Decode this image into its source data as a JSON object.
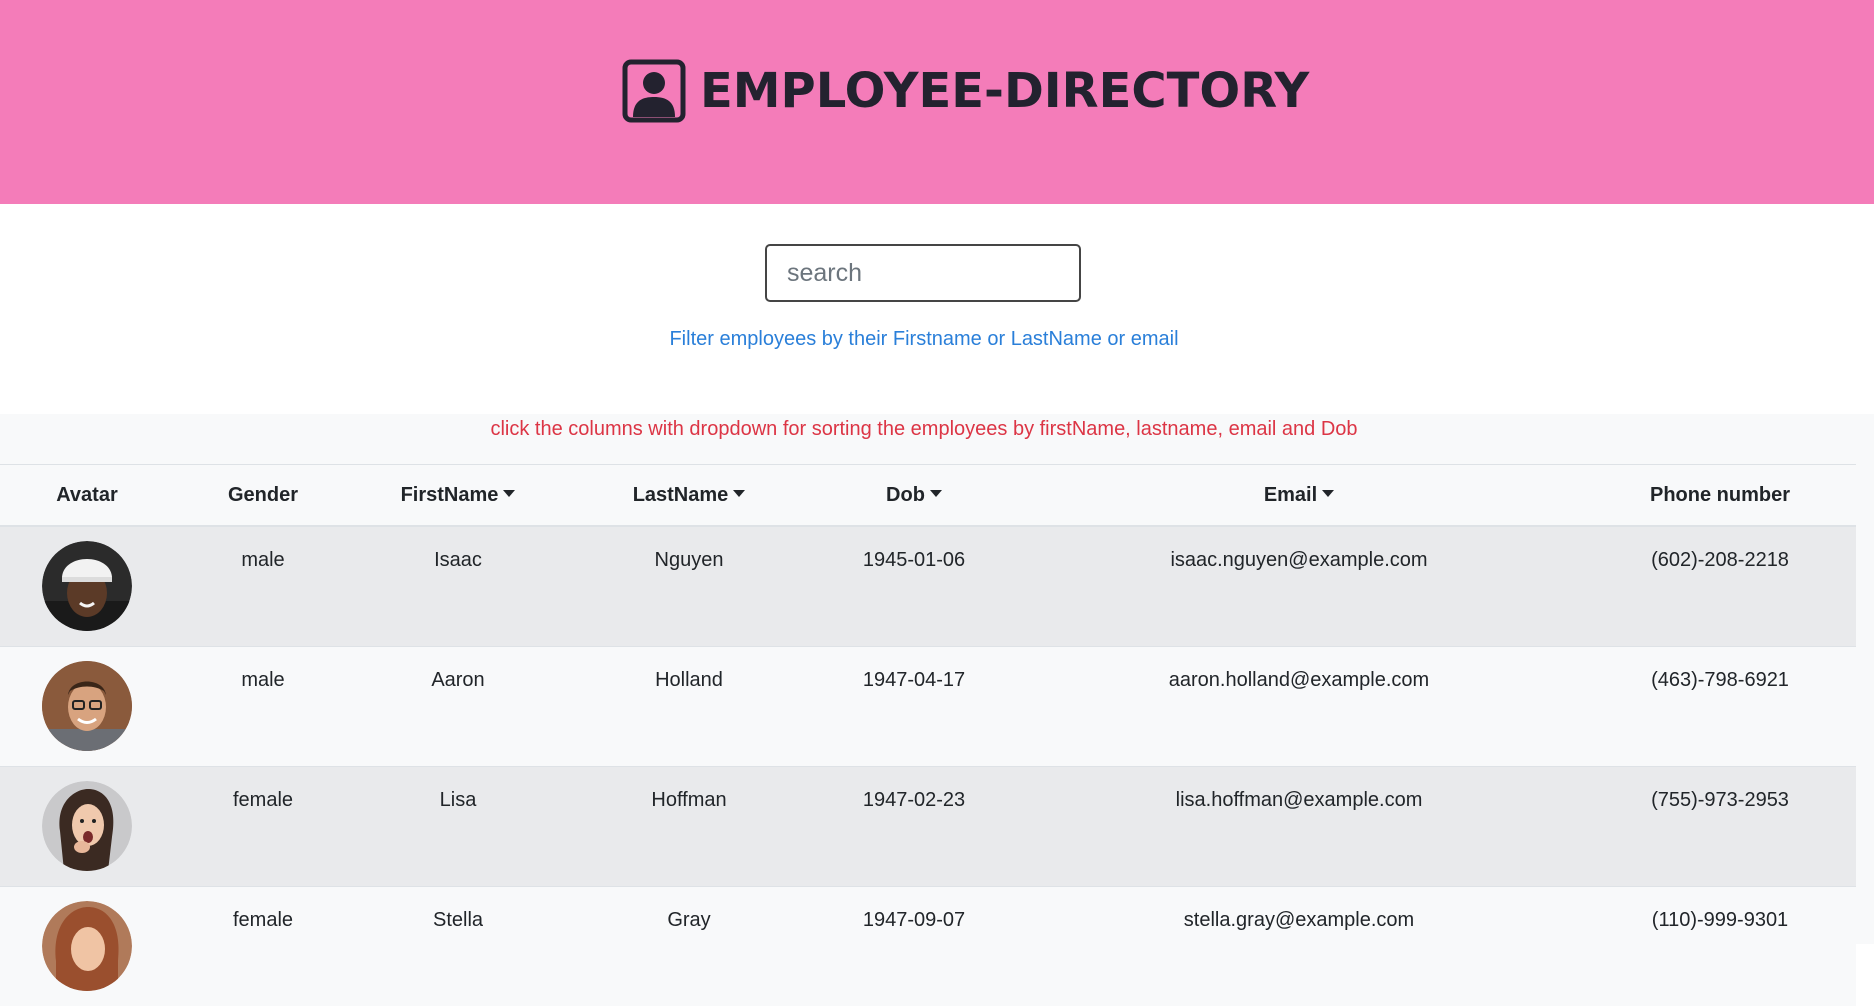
{
  "app": {
    "title": "EMPLOYEE-DIRECTORY"
  },
  "search": {
    "placeholder": "search",
    "value": "",
    "hint": "Filter employees by their Firstname or LastName or email"
  },
  "table": {
    "sort_note": "click the columns with dropdown for sorting the employees by firstName, lastname, email and Dob",
    "columns": [
      {
        "label": "Avatar",
        "sortable": false
      },
      {
        "label": "Gender",
        "sortable": false
      },
      {
        "label": "FirstName",
        "sortable": true
      },
      {
        "label": "LastName",
        "sortable": true
      },
      {
        "label": "Dob",
        "sortable": true
      },
      {
        "label": "Email",
        "sortable": true
      },
      {
        "label": "Phone number",
        "sortable": false
      }
    ],
    "rows": [
      {
        "avatar": "avatar-man-white-cap",
        "gender": "male",
        "first": "Isaac",
        "last": "Nguyen",
        "dob": "1945-01-06",
        "email": "isaac.nguyen@example.com",
        "phone": "(602)-208-2218"
      },
      {
        "avatar": "avatar-man-glasses",
        "gender": "male",
        "first": "Aaron",
        "last": "Holland",
        "dob": "1947-04-17",
        "email": "aaron.holland@example.com",
        "phone": "(463)-798-6921"
      },
      {
        "avatar": "avatar-woman-surprised",
        "gender": "female",
        "first": "Lisa",
        "last": "Hoffman",
        "dob": "1947-02-23",
        "email": "lisa.hoffman@example.com",
        "phone": "(755)-973-2953"
      },
      {
        "avatar": "avatar-woman-auburn",
        "gender": "female",
        "first": "Stella",
        "last": "Gray",
        "dob": "1947-09-07",
        "email": "stella.gray@example.com",
        "phone": "(110)-999-9301"
      }
    ]
  },
  "colors": {
    "header_bg": "#f47cb9",
    "hint": "#2a7fd9",
    "sort_note": "#dc3545"
  }
}
